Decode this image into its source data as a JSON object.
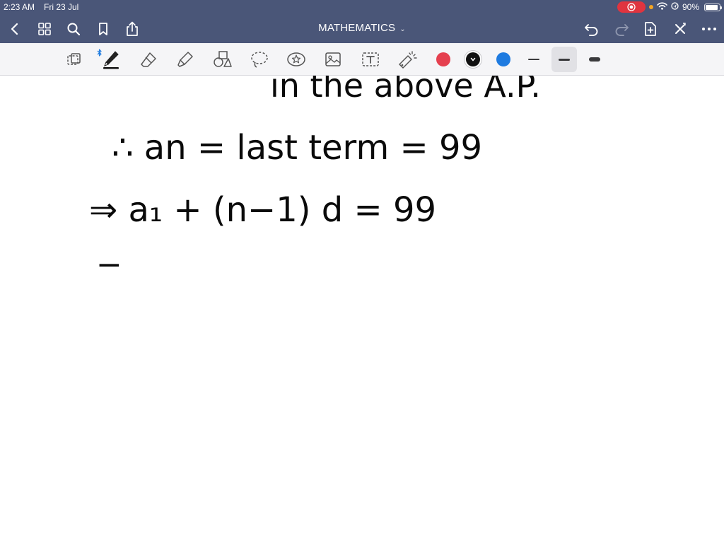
{
  "status_bar": {
    "time": "2:23 AM",
    "date": "Fri 23 Jul",
    "battery_percent": "90%",
    "battery_level": 0.9,
    "icons": [
      "screen-record-icon",
      "orange-dot-indicator",
      "wifi-icon",
      "location-icon",
      "battery-icon"
    ]
  },
  "nav": {
    "title": "MATHEMATICS",
    "title_chevron": "⌄",
    "left_icons": [
      "back-icon",
      "thumbnails-grid-icon",
      "search-icon",
      "bookmark-icon",
      "share-icon"
    ],
    "right_icons": [
      "undo-icon",
      "redo-icon",
      "add-page-icon",
      "close-icon",
      "more-icon"
    ]
  },
  "toolbar": {
    "tools": [
      "page-select-tool",
      "pen-tool",
      "eraser-tool",
      "highlighter-tool",
      "shapes-tool",
      "lasso-tool",
      "sticker-tool",
      "image-tool",
      "text-tool",
      "laser-pointer-tool"
    ],
    "active_tool": "pen-tool",
    "colors": [
      "#e5404f",
      "#111111",
      "#1e7be0"
    ],
    "selected_color": "#111111",
    "stroke_widths": [
      "thin",
      "medium",
      "thick"
    ],
    "selected_stroke": "medium"
  },
  "canvas": {
    "lines": [
      "in the above A.P.",
      "∴  an = last term = 99",
      "⇒  a₁ + (n−1) d  =  99",
      "−"
    ]
  },
  "colors": {
    "nav_background": "#4a5678",
    "toolbar_background": "#f5f5f7",
    "ink": "#0a0a0a"
  }
}
